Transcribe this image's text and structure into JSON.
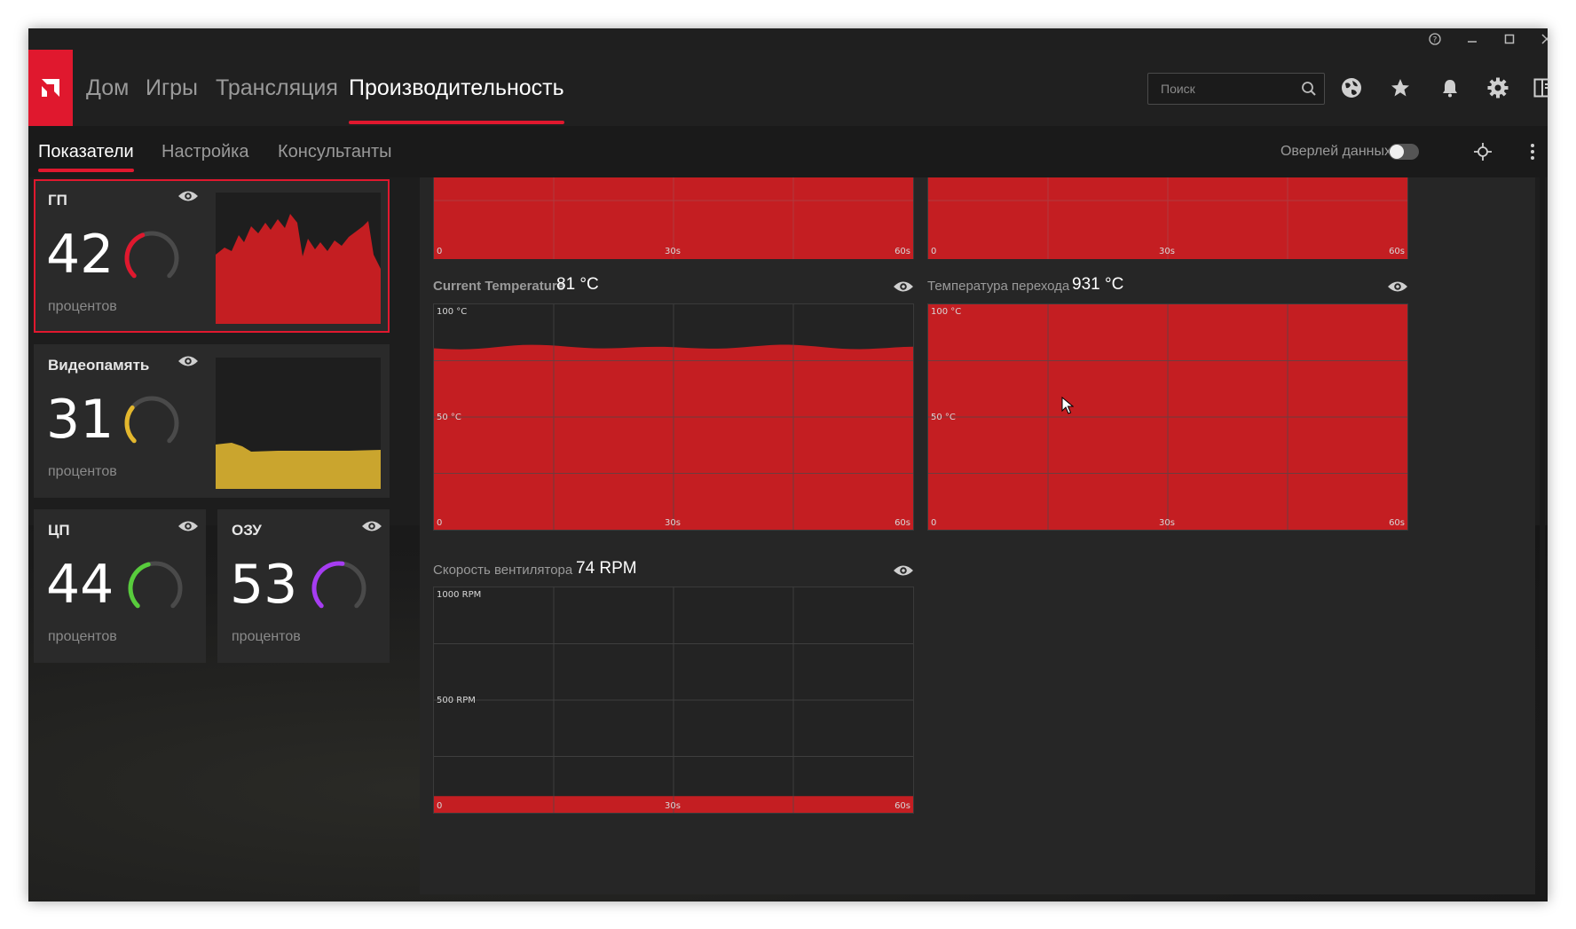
{
  "colors": {
    "accent": "#e0182e",
    "graph_fill": "#c41e22",
    "vram": "#e3b72d",
    "cpu": "#58cc3c",
    "ram": "#a63cf2"
  },
  "nav": {
    "tabs": [
      {
        "label": "Дом"
      },
      {
        "label": "Игры"
      },
      {
        "label": "Трансляция"
      },
      {
        "label": "Производительность"
      }
    ],
    "active_tab": "Производительность",
    "search_placeholder": "Поиск",
    "icons": [
      "globe-icon",
      "star-icon",
      "bell-icon",
      "gear-icon",
      "panel-icon"
    ]
  },
  "window_controls": [
    "help-icon",
    "minimize-icon",
    "maximize-icon",
    "close-icon"
  ],
  "subnav": {
    "tabs": [
      {
        "label": "Показатели"
      },
      {
        "label": "Настройка"
      },
      {
        "label": "Консультанты"
      }
    ],
    "active_tab": "Показатели",
    "overlay_label": "Оверлей данных",
    "overlay_enabled": false
  },
  "cards": {
    "gpu": {
      "title": "ГП",
      "value": "42",
      "unit": "процентов",
      "percent": 42
    },
    "vram": {
      "title": "Видеопамять",
      "value": "31",
      "unit": "процентов",
      "percent": 31
    },
    "cpu": {
      "title": "ЦП",
      "value": "44",
      "unit": "процентов",
      "percent": 44
    },
    "ram": {
      "title": "ОЗУ",
      "value": "53",
      "unit": "процентов",
      "percent": 53
    }
  },
  "metrics": {
    "top_left": {
      "x_labels": [
        "0",
        "30s",
        "60s"
      ]
    },
    "top_right": {
      "x_labels": [
        "0",
        "30s",
        "60s"
      ]
    },
    "current_temp": {
      "label": "Current Temperature",
      "value": "81 °C",
      "y_labels": [
        "100 °C",
        "50 °C"
      ],
      "x_labels": [
        "0",
        "30s",
        "60s"
      ],
      "level": 81
    },
    "junction_temp": {
      "label": "Температура перехода",
      "value": "931 °C",
      "y_labels": [
        "100 °C",
        "50 °C"
      ],
      "x_labels": [
        "0",
        "30s",
        "60s"
      ],
      "level": 100
    },
    "fan_speed": {
      "label": "Скорость вентилятора",
      "value": "74 RPM",
      "y_labels": [
        "1000 RPM",
        "500 RPM"
      ],
      "x_labels": [
        "0",
        "30s",
        "60s"
      ],
      "level": 7.4
    }
  }
}
